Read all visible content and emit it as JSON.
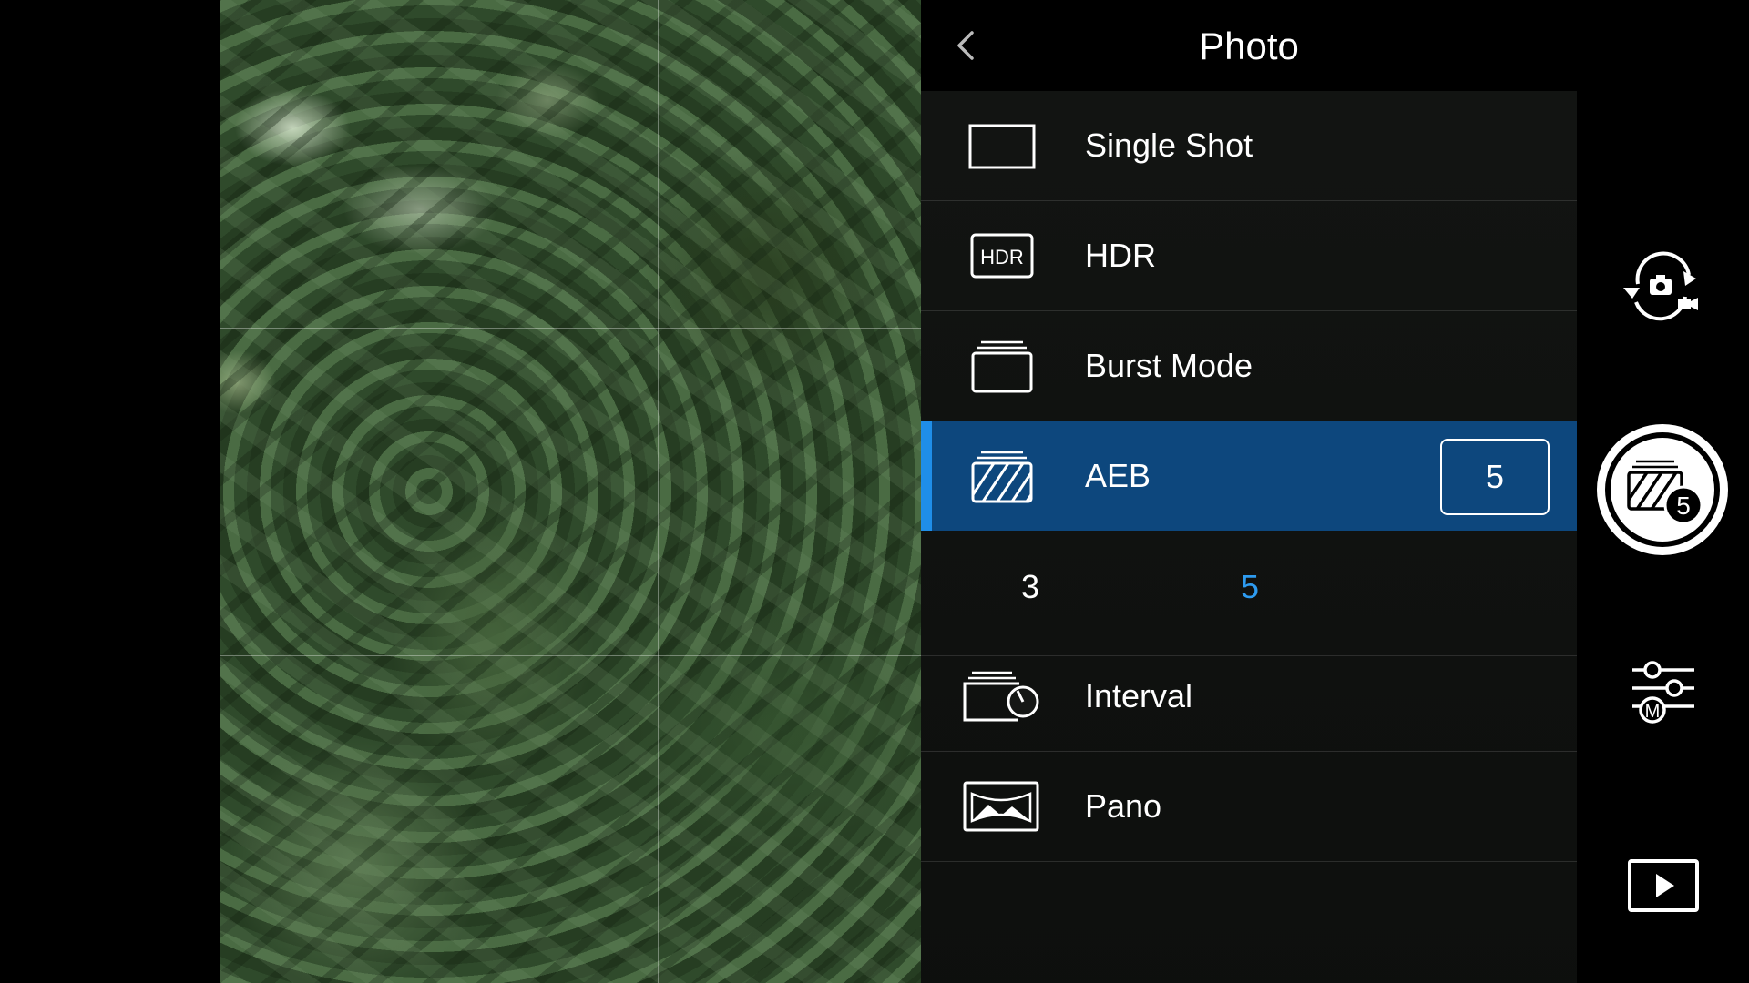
{
  "panel": {
    "title": "Photo",
    "modes": [
      {
        "label": "Single Shot",
        "icon": "single-shot-icon"
      },
      {
        "label": "HDR",
        "icon": "hdr-icon",
        "badge": "HDR"
      },
      {
        "label": "Burst Mode",
        "icon": "burst-icon"
      },
      {
        "label": "AEB",
        "icon": "aeb-icon",
        "selected": true,
        "value": "5"
      },
      {
        "label": "Interval",
        "icon": "interval-icon"
      },
      {
        "label": "Pano",
        "icon": "pano-icon"
      }
    ],
    "aeb_options": [
      "3",
      "5"
    ],
    "aeb_selected": "5"
  },
  "controls": {
    "shutter_count": "5",
    "params_badge": "M"
  },
  "colors": {
    "accent_blue": "#2e9bf0",
    "selected_row": "#0d477d"
  }
}
